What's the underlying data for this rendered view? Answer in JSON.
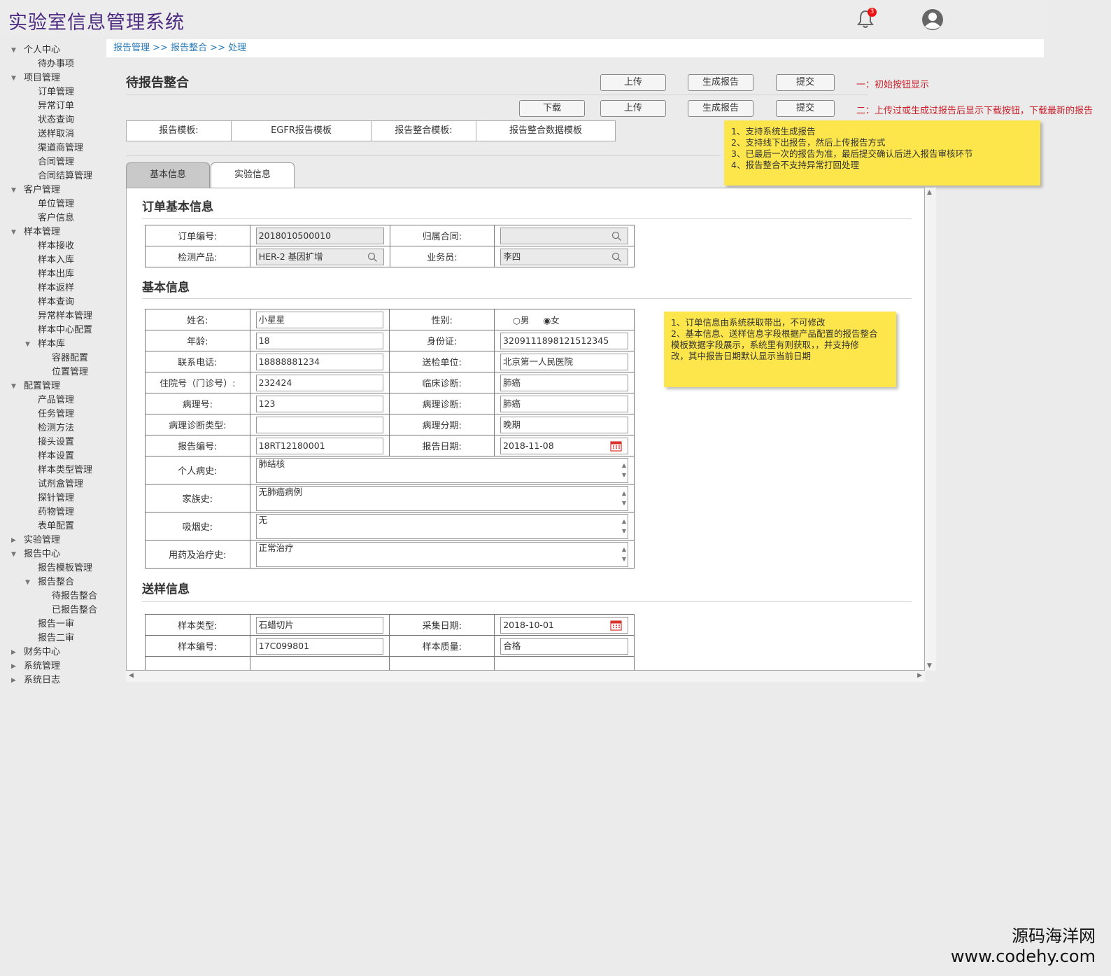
{
  "app": {
    "title": "实验室信息管理系统",
    "notification_count": "3"
  },
  "sidebar": [
    {
      "label": "个人中心",
      "level": 0,
      "arrow": "▼"
    },
    {
      "label": "待办事项",
      "level": 1,
      "arrow": ""
    },
    {
      "label": "项目管理",
      "level": 0,
      "arrow": "▼"
    },
    {
      "label": "订单管理",
      "level": 1,
      "arrow": ""
    },
    {
      "label": "异常订单",
      "level": 1,
      "arrow": ""
    },
    {
      "label": "状态查询",
      "level": 1,
      "arrow": ""
    },
    {
      "label": "送样取消",
      "level": 1,
      "arrow": ""
    },
    {
      "label": "渠道商管理",
      "level": 1,
      "arrow": ""
    },
    {
      "label": "合同管理",
      "level": 1,
      "arrow": ""
    },
    {
      "label": "合同结算管理",
      "level": 1,
      "arrow": ""
    },
    {
      "label": "客户管理",
      "level": 0,
      "arrow": "▼"
    },
    {
      "label": "单位管理",
      "level": 1,
      "arrow": ""
    },
    {
      "label": "客户信息",
      "level": 1,
      "arrow": ""
    },
    {
      "label": "样本管理",
      "level": 0,
      "arrow": "▼"
    },
    {
      "label": "样本接收",
      "level": 1,
      "arrow": ""
    },
    {
      "label": "样本入库",
      "level": 1,
      "arrow": ""
    },
    {
      "label": "样本出库",
      "level": 1,
      "arrow": ""
    },
    {
      "label": "样本返样",
      "level": 1,
      "arrow": ""
    },
    {
      "label": "样本查询",
      "level": 1,
      "arrow": ""
    },
    {
      "label": "异常样本管理",
      "level": 1,
      "arrow": ""
    },
    {
      "label": "样本中心配置",
      "level": 1,
      "arrow": ""
    },
    {
      "label": "样本库",
      "level": 1,
      "arrow": "▼"
    },
    {
      "label": "容器配置",
      "level": 2,
      "arrow": ""
    },
    {
      "label": "位置管理",
      "level": 2,
      "arrow": ""
    },
    {
      "label": "配置管理",
      "level": 0,
      "arrow": "▼"
    },
    {
      "label": "产品管理",
      "level": 1,
      "arrow": ""
    },
    {
      "label": "任务管理",
      "level": 1,
      "arrow": ""
    },
    {
      "label": "检测方法",
      "level": 1,
      "arrow": ""
    },
    {
      "label": "接头设置",
      "level": 1,
      "arrow": ""
    },
    {
      "label": "样本设置",
      "level": 1,
      "arrow": ""
    },
    {
      "label": "样本类型管理",
      "level": 1,
      "arrow": ""
    },
    {
      "label": "试剂盒管理",
      "level": 1,
      "arrow": ""
    },
    {
      "label": "探针管理",
      "level": 1,
      "arrow": ""
    },
    {
      "label": "药物管理",
      "level": 1,
      "arrow": ""
    },
    {
      "label": "表单配置",
      "level": 1,
      "arrow": ""
    },
    {
      "label": "实验管理",
      "level": 0,
      "arrow": "▶"
    },
    {
      "label": "报告中心",
      "level": 0,
      "arrow": "▼"
    },
    {
      "label": "报告模板管理",
      "level": 1,
      "arrow": ""
    },
    {
      "label": "报告整合",
      "level": 1,
      "arrow": "▼"
    },
    {
      "label": "待报告整合",
      "level": 2,
      "arrow": ""
    },
    {
      "label": "已报告整合",
      "level": 2,
      "arrow": ""
    },
    {
      "label": "报告一审",
      "level": 1,
      "arrow": ""
    },
    {
      "label": "报告二审",
      "level": 1,
      "arrow": ""
    },
    {
      "label": "财务中心",
      "level": 0,
      "arrow": "▶"
    },
    {
      "label": "系统管理",
      "level": 0,
      "arrow": "▶"
    },
    {
      "label": "系统日志",
      "level": 0,
      "arrow": "▶"
    }
  ],
  "breadcrumb": "报告管理 >> 报告整合   >> 处理",
  "page": {
    "title": "待报告整合"
  },
  "buttons": {
    "row1": {
      "upload": "上传",
      "generate": "生成报告",
      "submit": "提交"
    },
    "row2": {
      "download": "下载",
      "upload": "上传",
      "generate": "生成报告",
      "submit": "提交"
    }
  },
  "notes": {
    "row1": "一：初始按钮显示",
    "row2": "二：上传过或生成过报告后显示下载按钮，下载最新的报告",
    "sticky1": [
      "1、支持系统生成报告",
      "2、支持线下出报告，然后上传报告方式",
      "3、已最后一次的报告为准，最后提交确认后进入报告审核环节",
      "4、报告整合不支持异常打回处理"
    ],
    "sticky2": [
      "1、订单信息由系统获取带出，不可修改",
      "2、基本信息、送样信息字段根据产品配置的报告整合",
      "模板数据字段展示，系统里有则获取，，并支持修",
      "改，其中报告日期默认显示当前日期"
    ]
  },
  "template_row": {
    "label1": "报告模板:",
    "value1": "EGFR报告模板",
    "label2": "报告整合模板:",
    "value2": "报告整合数据模板"
  },
  "tabs": {
    "basic": "基本信息",
    "experiment": "实验信息"
  },
  "order_section": {
    "title": "订单基本信息",
    "order_no_label": "订单编号:",
    "order_no": "2018010500010",
    "contract_label": "归属合同:",
    "contract": "",
    "product_label": "检测产品:",
    "product": "HER-2 基因扩增",
    "salesman_label": "业务员:",
    "salesman": "李四"
  },
  "basic_section": {
    "title": "基本信息",
    "name_label": "姓名:",
    "name": "小星星",
    "gender_label": "性别:",
    "gender_male": "男",
    "gender_female": "女",
    "age_label": "年龄:",
    "age": "18",
    "idcard_label": "身份证:",
    "idcard": "320911189812151​2345",
    "phone_label": "联系电话:",
    "phone": "18888881234",
    "hospital_label": "送检单位:",
    "hospital": "北京第一人民医院",
    "inpatient_label": "住院号（门诊号）:",
    "inpatient": "232424",
    "clinical_label": "临床诊断:",
    "clinical": "肺癌",
    "pathology_no_label": "病理号:",
    "pathology_no": "123",
    "pathology_diag_label": "病理诊断:",
    "pathology_diag": "肺癌",
    "pathology_type_label": "病理诊断类型:",
    "pathology_type": "",
    "stage_label": "病理分期:",
    "stage": "晚期",
    "report_no_label": "报告编号:",
    "report_no": "18RT12180001",
    "report_date_label": "报告日期:",
    "report_date": "2018-11-08",
    "history_label": "个人病史:",
    "history": "肺结核",
    "family_label": "家族史:",
    "family": "无肺癌病例",
    "smoking_label": "吸烟史:",
    "smoking": "无",
    "treatment_label": "用药及治疗史:",
    "treatment": "正常治疗"
  },
  "sample_section": {
    "title": "送样信息",
    "type_label": "样本类型:",
    "type": "石蜡切片",
    "collect_label": "采集日期:",
    "collect": "2018-10-01",
    "no_label": "样本编号:",
    "no": "17C099801",
    "quality_label": "样本质量:",
    "quality": "合格"
  },
  "watermark": {
    "line1": "源码海洋网",
    "line2": "www.codehy.com"
  },
  "colors": {
    "title": "#4b2a80",
    "link": "#2a7bb8",
    "note_red": "#c9202a",
    "sticky": "#fde64b",
    "calendar": "#d9312b"
  }
}
